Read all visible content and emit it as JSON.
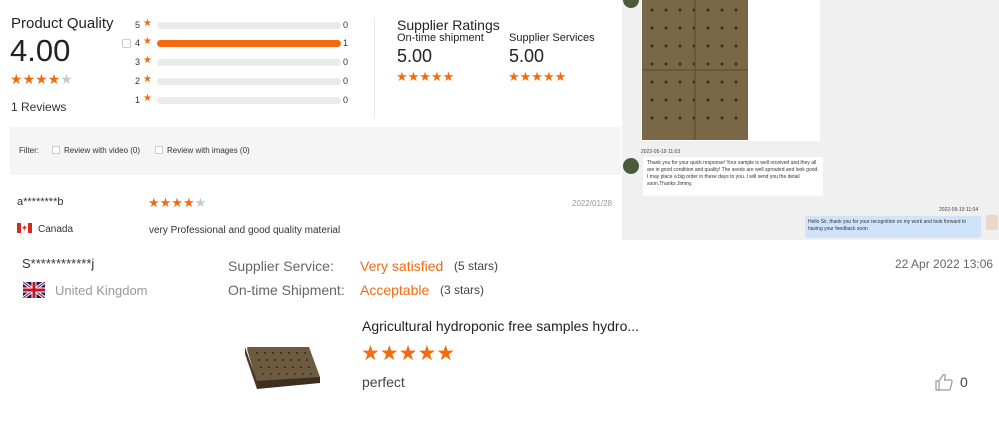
{
  "product_quality": {
    "title": "Product Quality",
    "score": "4.00",
    "stars": 4,
    "reviews_label": "1 Reviews",
    "distribution": [
      {
        "stars": "5",
        "count": "0",
        "fraction": 0
      },
      {
        "stars": "4",
        "count": "1",
        "fraction": 1
      },
      {
        "stars": "3",
        "count": "0",
        "fraction": 0
      },
      {
        "stars": "2",
        "count": "0",
        "fraction": 0
      },
      {
        "stars": "1",
        "count": "0",
        "fraction": 0
      }
    ]
  },
  "supplier_ratings": {
    "title": "Supplier Ratings",
    "on_time_label": "On-time shipment",
    "on_time_value": "5.00",
    "services_label": "Supplier Services",
    "services_value": "5.00"
  },
  "filter": {
    "label": "Filter:",
    "video_label": "Review with video (0)",
    "images_label": "Review with images (0)"
  },
  "review1": {
    "name": "a********b",
    "stars": 4,
    "date": "2022/01/28",
    "country": "Canada",
    "text": "very Professional and good quality material"
  },
  "chat": {
    "time1": "2022-05-19 11:03",
    "message1": "Thank you for your quick response! Your sample is well received and they all are in good condition and quality! The seeds are well sprouted and look good. I may place a big order in these days to you. I will send you the detail soon.Thanks Jimmy.",
    "time2": "2022-05-19 11:04",
    "message2": "Hello Sir, thank you for your recognition on my work and look forward to having your feedback soon"
  },
  "review2": {
    "name": "S************j",
    "country": "United Kingdom",
    "supplier_service_label": "Supplier Service:",
    "supplier_service_value": "Very satisfied",
    "supplier_service_stars": "(5 stars)",
    "on_time_label": "On-time Shipment:",
    "on_time_value": "Acceptable",
    "on_time_stars": "(3 stars)",
    "date": "22 Apr 2022 13:06",
    "product_title": "Agricultural hydroponic free samples hydro...",
    "stars": 5,
    "comment": "perfect",
    "likes": "0"
  },
  "colors": {
    "accent": "#f26b0f",
    "track": "#ebebeb",
    "filter_bg": "#f5f5f5"
  },
  "icons": [
    "star-icon",
    "thumbs-up-icon",
    "canada-flag-icon",
    "uk-flag-icon"
  ]
}
